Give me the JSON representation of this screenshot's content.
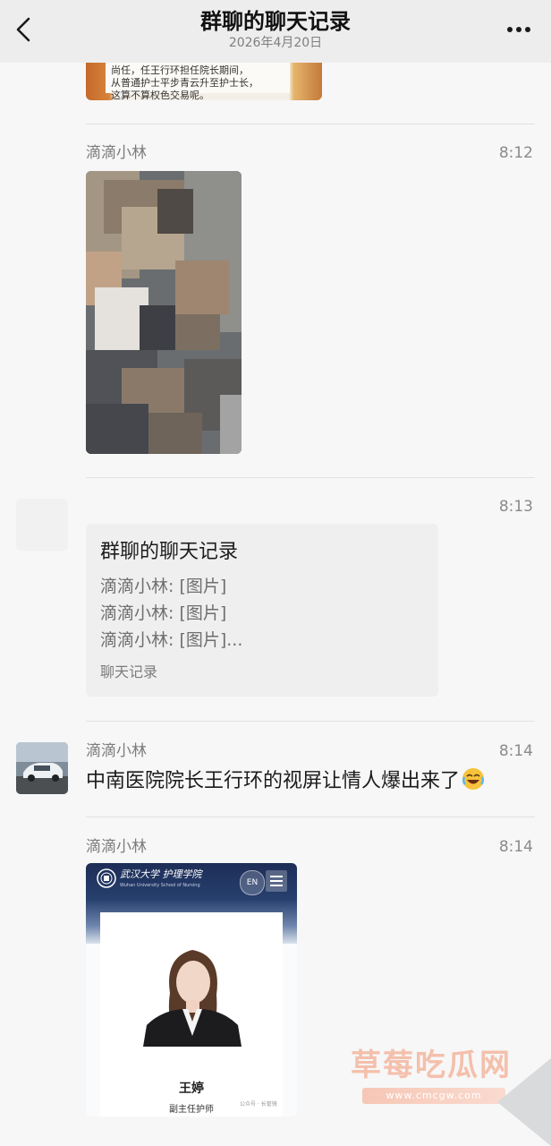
{
  "header": {
    "title": "群聊的聊天记录",
    "date": "2026年4月20日",
    "back_icon": "back-chevron-icon",
    "more_icon": "more-dots-icon"
  },
  "top_image": {
    "caption_lines": [
      "尚任，任王行环担任院长期间，",
      "从普通护士平步青云升至护士长，",
      "这算不算权色交易呢。"
    ]
  },
  "messages": [
    {
      "sender": "滴滴小林",
      "time": "8:12",
      "type": "image"
    },
    {
      "sender": "",
      "time": "8:13",
      "type": "chat-record",
      "card": {
        "title": "群聊的聊天记录",
        "lines": [
          "滴滴小林: [图片]",
          "滴滴小林: [图片]",
          "滴滴小林: [图片]..."
        ],
        "footer": "聊天记录"
      }
    },
    {
      "sender": "滴滴小林",
      "time": "8:14",
      "type": "text",
      "text": "中南医院院长王行环的视屏让情人爆出来了",
      "emoji": "laughing-crying-emoji-icon"
    },
    {
      "sender": "滴滴小林",
      "time": "8:14",
      "type": "image",
      "profile": {
        "school_name": "武汉大学 护理学院",
        "school_sub": "Wuhan University School of Nursing",
        "lang_button": "EN",
        "name": "王婷",
        "title": "副主任护师",
        "source": "公众号 · 长管镜"
      }
    }
  ],
  "watermark": {
    "text": "草莓吃瓜网",
    "url": "www.cmcgw.com"
  },
  "colors": {
    "header_bg": "#ededed",
    "page_bg": "#f7f7f7",
    "card_bg": "#efefef",
    "watermark": "#f4b79f"
  }
}
